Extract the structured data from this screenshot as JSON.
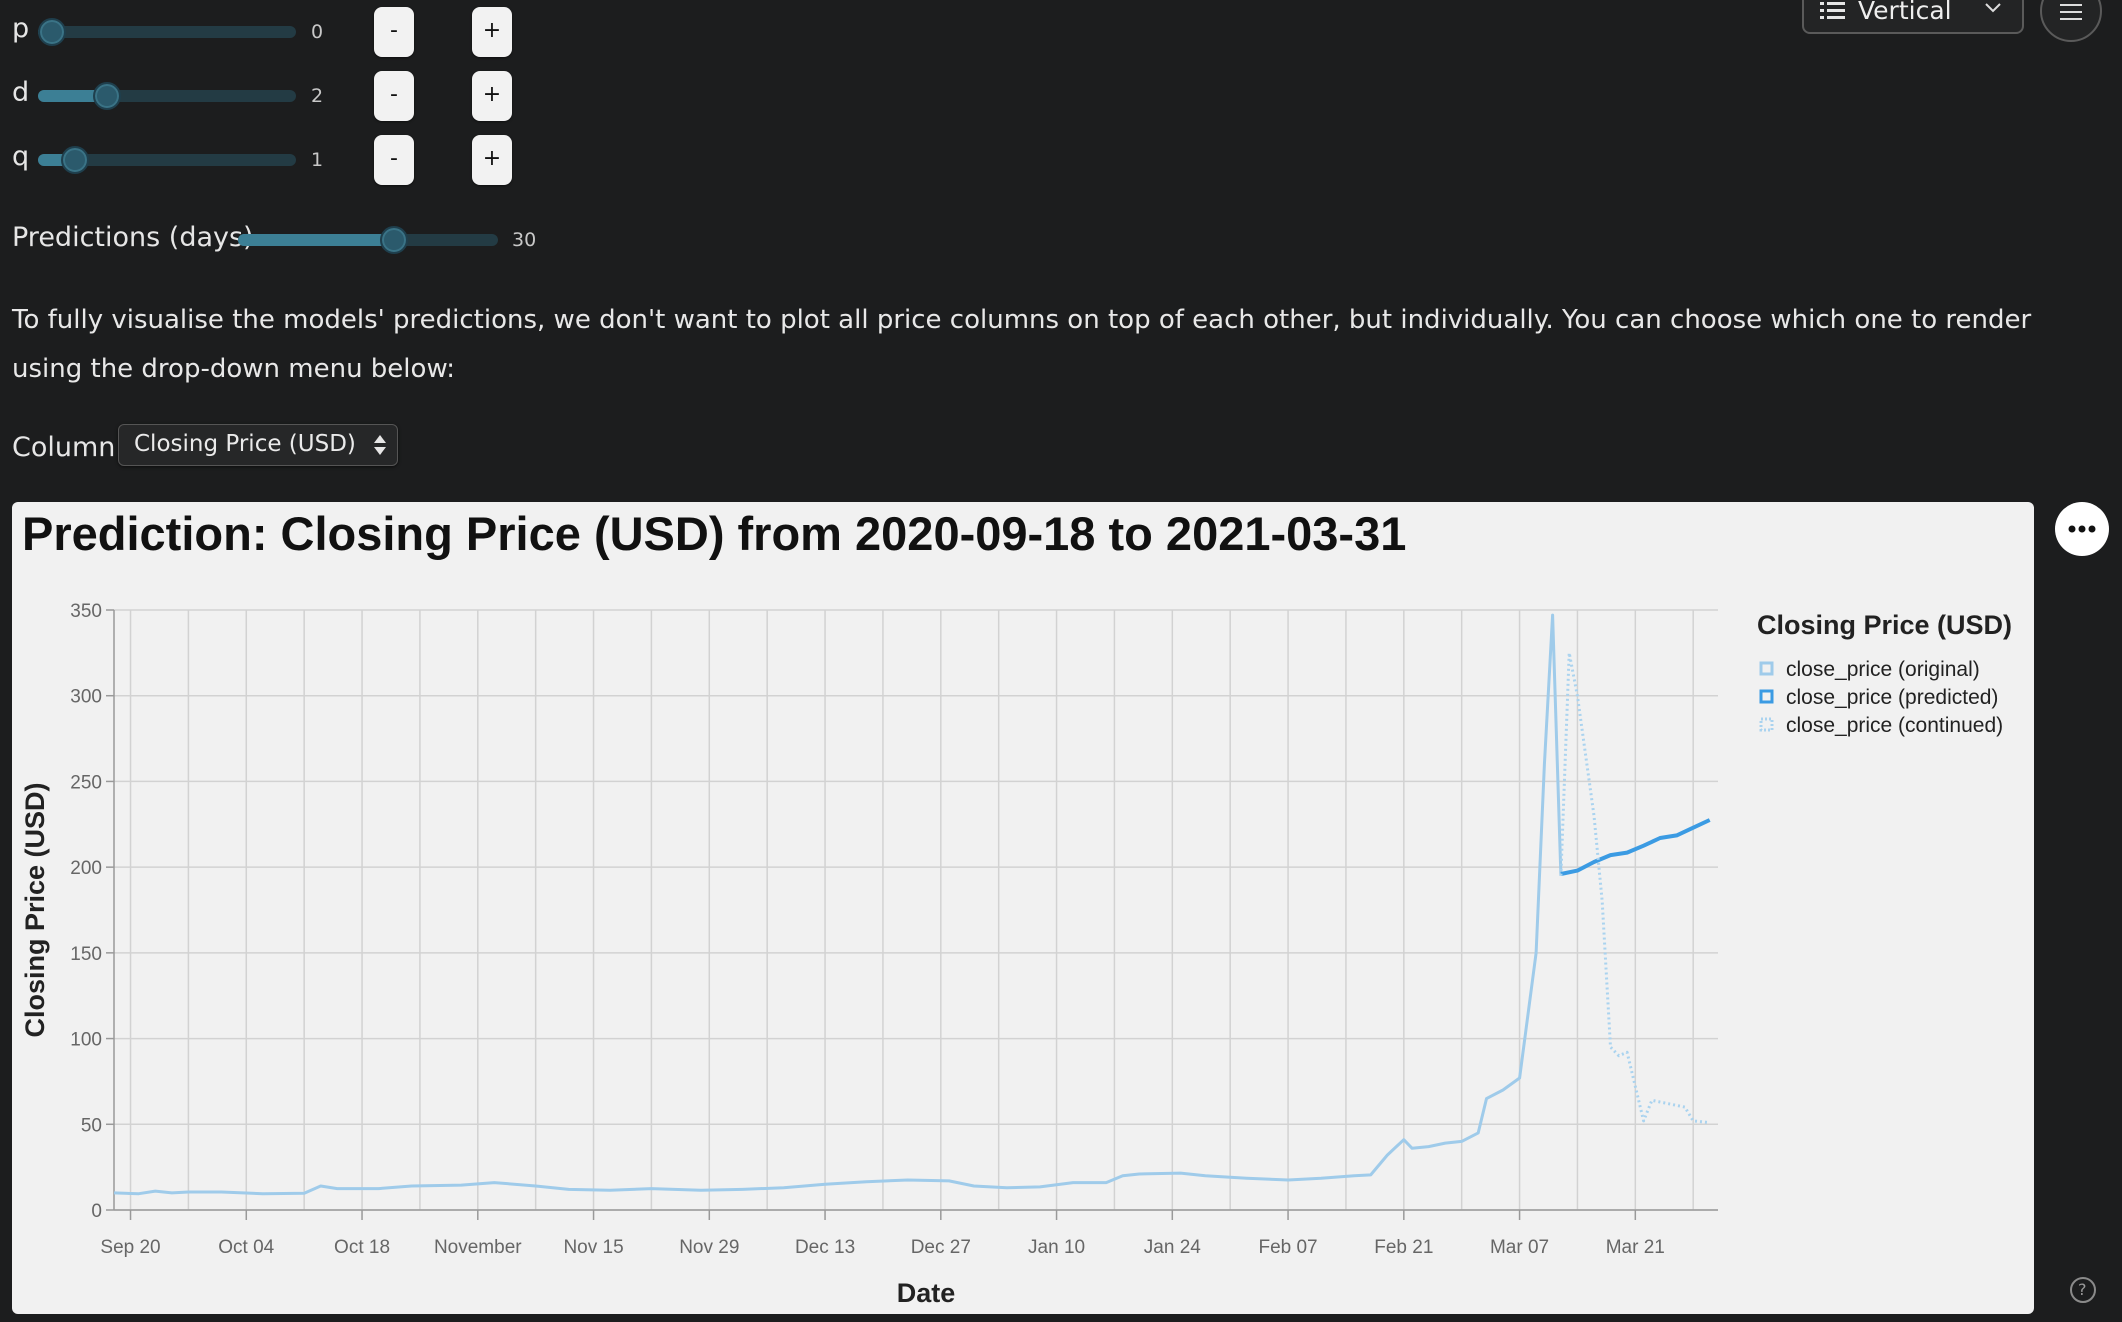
{
  "params": [
    {
      "label": "p",
      "value": "0",
      "fraction": 0.0
    },
    {
      "label": "d",
      "value": "2",
      "fraction": 0.24
    },
    {
      "label": "q",
      "value": "1",
      "fraction": 0.1
    }
  ],
  "stepper": {
    "minus": "-",
    "plus": "+"
  },
  "predictions": {
    "label": "Predictions (days)",
    "value": "30",
    "fraction": 0.61
  },
  "description": "To fully visualise the models' predictions, we don't want to plot all price columns on top of each other, but individually. You can choose which one to render using the drop-down menu below:",
  "column_select": {
    "label": "Column",
    "value": "Closing Price (USD)"
  },
  "toolbar": {
    "layout_label": "Vertical",
    "menu_icon": "hamburger-icon",
    "list_icon": "list-icon",
    "chevron_icon": "chevron-down-icon"
  },
  "more_icon": "ellipsis-icon",
  "help_icon": "question-circle-icon",
  "colors": {
    "original": "#9fcbea",
    "predicted": "#3b9be3",
    "continued": "#aad3ef",
    "accent": "#3c7f95"
  },
  "chart_data": {
    "type": "line",
    "title": "Prediction: Closing Price (USD) from 2020-09-18 to 2021-03-31",
    "xlabel": "Date",
    "ylabel": "Closing Price (USD)",
    "ylim": [
      0,
      350
    ],
    "xlim": [
      "2020-09-18",
      "2021-03-31"
    ],
    "yticks": [
      0,
      50,
      100,
      150,
      200,
      250,
      300,
      350
    ],
    "xticks": [
      {
        "date": "2020-09-20",
        "label": "Sep 20"
      },
      {
        "date": "2020-10-04",
        "label": "Oct 04"
      },
      {
        "date": "2020-10-18",
        "label": "Oct 18"
      },
      {
        "date": "2020-11-01",
        "label": "November"
      },
      {
        "date": "2020-11-15",
        "label": "Nov 15"
      },
      {
        "date": "2020-11-29",
        "label": "Nov 29"
      },
      {
        "date": "2020-12-13",
        "label": "Dec 13"
      },
      {
        "date": "2020-12-27",
        "label": "Dec 27"
      },
      {
        "date": "2021-01-10",
        "label": "Jan 10"
      },
      {
        "date": "2021-01-24",
        "label": "Jan 24"
      },
      {
        "date": "2021-02-07",
        "label": "Feb 07"
      },
      {
        "date": "2021-02-21",
        "label": "Feb 21"
      },
      {
        "date": "2021-03-07",
        "label": "Mar 07"
      },
      {
        "date": "2021-03-21",
        "label": "Mar 21"
      }
    ],
    "grid": true,
    "legend": {
      "title": "Closing Price (USD)",
      "placement": "right"
    },
    "series": [
      {
        "name": "close_price (original)",
        "style": "solid",
        "points": [
          [
            "2020-09-18",
            10
          ],
          [
            "2020-09-21",
            9.5
          ],
          [
            "2020-09-23",
            11
          ],
          [
            "2020-09-25",
            10
          ],
          [
            "2020-09-27",
            10.5
          ],
          [
            "2020-10-01",
            10.5
          ],
          [
            "2020-10-06",
            9.5
          ],
          [
            "2020-10-11",
            9.8
          ],
          [
            "2020-10-13",
            14
          ],
          [
            "2020-10-15",
            12.5
          ],
          [
            "2020-10-20",
            12.5
          ],
          [
            "2020-10-24",
            14
          ],
          [
            "2020-10-30",
            14.5
          ],
          [
            "2020-11-03",
            16
          ],
          [
            "2020-11-08",
            14
          ],
          [
            "2020-11-12",
            12
          ],
          [
            "2020-11-17",
            11.5
          ],
          [
            "2020-11-22",
            12.5
          ],
          [
            "2020-11-28",
            11.5
          ],
          [
            "2020-12-03",
            12
          ],
          [
            "2020-12-08",
            13
          ],
          [
            "2020-12-13",
            15
          ],
          [
            "2020-12-18",
            16.5
          ],
          [
            "2020-12-23",
            17.5
          ],
          [
            "2020-12-28",
            17
          ],
          [
            "2020-12-31",
            14
          ],
          [
            "2021-01-04",
            13
          ],
          [
            "2021-01-08",
            13.5
          ],
          [
            "2021-01-12",
            16
          ],
          [
            "2021-01-16",
            16
          ],
          [
            "2021-01-18",
            20
          ],
          [
            "2021-01-20",
            21
          ],
          [
            "2021-01-25",
            21.5
          ],
          [
            "2021-01-28",
            20
          ],
          [
            "2021-02-02",
            18.5
          ],
          [
            "2021-02-07",
            17.5
          ],
          [
            "2021-02-11",
            18.5
          ],
          [
            "2021-02-15",
            20
          ],
          [
            "2021-02-17",
            20.5
          ],
          [
            "2021-02-19",
            32
          ],
          [
            "2021-02-21",
            41
          ],
          [
            "2021-02-22",
            36
          ],
          [
            "2021-02-24",
            37
          ],
          [
            "2021-02-26",
            39
          ],
          [
            "2021-02-28",
            40
          ],
          [
            "2021-03-02",
            45
          ],
          [
            "2021-03-03",
            65
          ],
          [
            "2021-03-05",
            70
          ],
          [
            "2021-03-07",
            77
          ],
          [
            "2021-03-09",
            150
          ],
          [
            "2021-03-10",
            260
          ],
          [
            "2021-03-11",
            347
          ],
          [
            "2021-03-12",
            195
          ]
        ]
      },
      {
        "name": "close_price (predicted)",
        "style": "solid",
        "points": [
          [
            "2021-03-12",
            196
          ],
          [
            "2021-03-14",
            198
          ],
          [
            "2021-03-16",
            203
          ],
          [
            "2021-03-18",
            207
          ],
          [
            "2021-03-20",
            208.5
          ],
          [
            "2021-03-22",
            212.5
          ],
          [
            "2021-03-24",
            217
          ],
          [
            "2021-03-26",
            218.5
          ],
          [
            "2021-03-28",
            223
          ],
          [
            "2021-03-30",
            227.5
          ]
        ]
      },
      {
        "name": "close_price (continued)",
        "style": "dotted",
        "points": [
          [
            "2021-03-12",
            195
          ],
          [
            "2021-03-13",
            325
          ],
          [
            "2021-03-14",
            300
          ],
          [
            "2021-03-16",
            230
          ],
          [
            "2021-03-17",
            180
          ],
          [
            "2021-03-18",
            95
          ],
          [
            "2021-03-19",
            90
          ],
          [
            "2021-03-20",
            92
          ],
          [
            "2021-03-22",
            52
          ],
          [
            "2021-03-23",
            64
          ],
          [
            "2021-03-25",
            62
          ],
          [
            "2021-03-27",
            60
          ],
          [
            "2021-03-28",
            52
          ],
          [
            "2021-03-30",
            51
          ]
        ]
      }
    ]
  }
}
